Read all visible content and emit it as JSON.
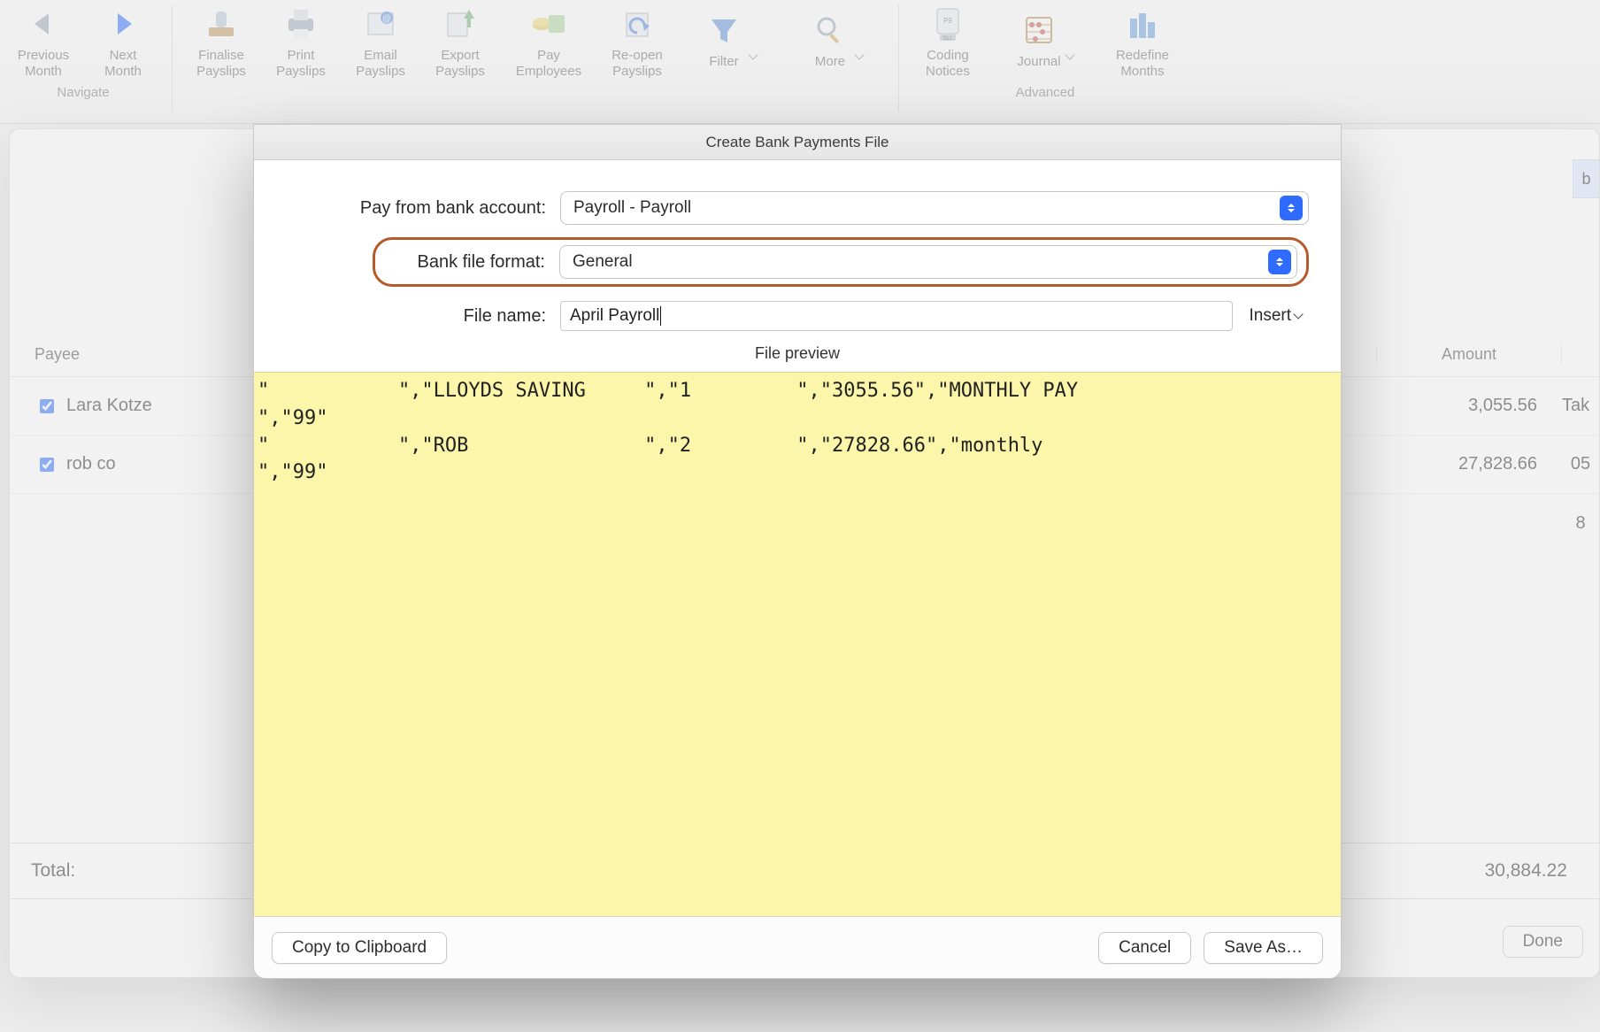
{
  "toolbar": {
    "groups": {
      "navigate": {
        "caption": "Navigate",
        "prev": "Previous\nMonth",
        "next": "Next\nMonth"
      },
      "payslips": {
        "finalise": "Finalise\nPayslips",
        "print": "Print\nPayslips",
        "email": "Email\nPayslips",
        "export": "Export\nPayslips",
        "pay": "Pay\nEmployees",
        "reopen": "Re-open\nPayslips",
        "filter": "Filter",
        "more": "More"
      },
      "advanced": {
        "caption": "Advanced",
        "coding": "Coding\nNotices",
        "journal": "Journal",
        "redefine": "Redefine\nMonths"
      }
    }
  },
  "table": {
    "headers": {
      "payee": "Payee",
      "amount": "Amount"
    },
    "rows": [
      {
        "name": "Lara Kotze",
        "amount": "3,055.56",
        "extra": "Tak"
      },
      {
        "name": "rob co",
        "amount": "27,828.66",
        "extra": "05"
      }
    ],
    "extra_rows": [
      {
        "extra": "8"
      }
    ],
    "total_label": "Total:",
    "total_value": "30,884.22",
    "done": "Done",
    "tab_letter": "b"
  },
  "modal": {
    "title": "Create Bank Payments File",
    "labels": {
      "account": "Pay from bank account:",
      "format": "Bank file format:",
      "filename": "File name:",
      "preview": "File preview"
    },
    "values": {
      "account": "Payroll - Payroll",
      "format": "General",
      "filename": "April Payroll"
    },
    "insert": "Insert",
    "preview_text": "\"           \",\"LLOYDS SAVING     \",\"1         \",\"3055.56\",\"MONTHLY PAY\n\",\"99\"\n\"           \",\"ROB               \",\"2         \",\"27828.66\",\"monthly\n\",\"99\"",
    "buttons": {
      "copy": "Copy to Clipboard",
      "cancel": "Cancel",
      "save": "Save As…"
    }
  }
}
